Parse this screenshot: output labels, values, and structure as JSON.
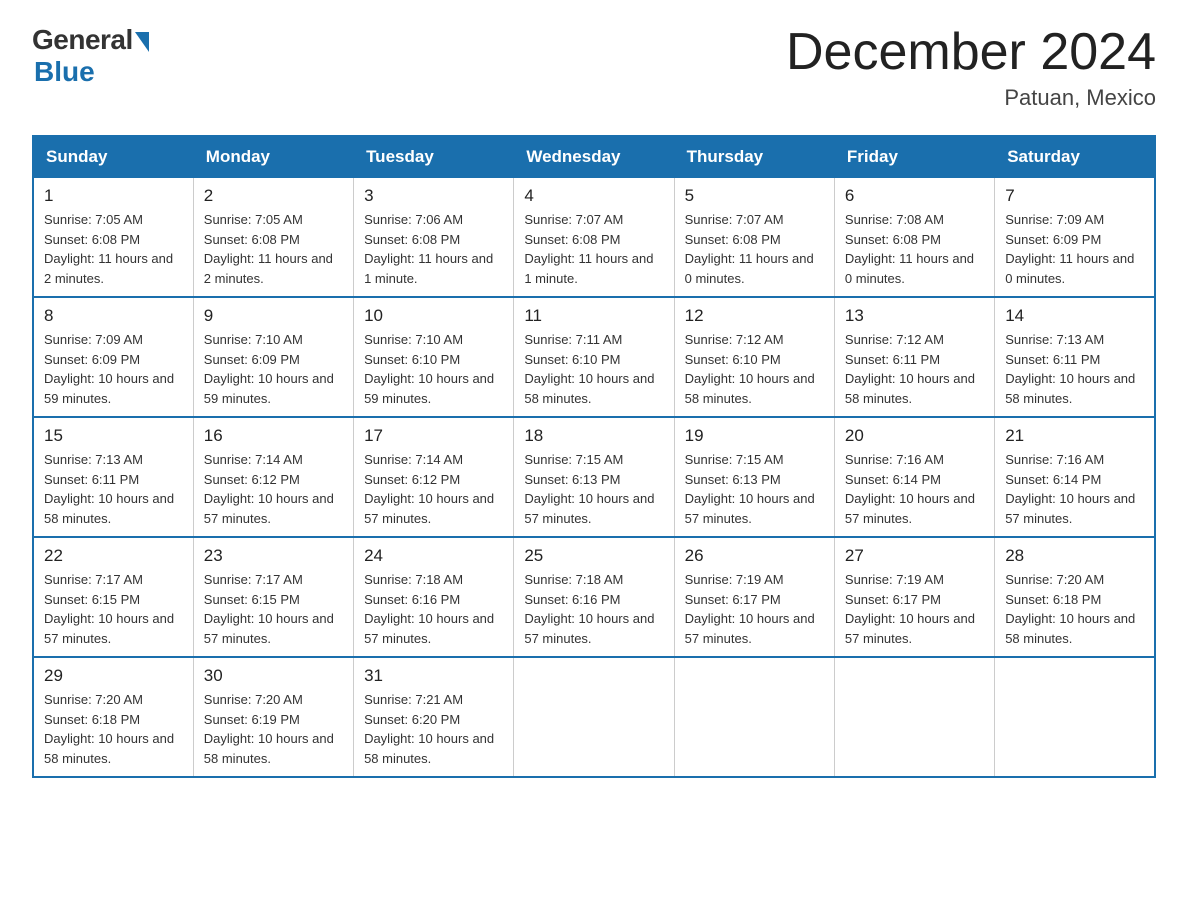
{
  "header": {
    "logo_general": "General",
    "logo_blue": "Blue",
    "month_title": "December 2024",
    "location": "Patuan, Mexico"
  },
  "calendar": {
    "days_of_week": [
      "Sunday",
      "Monday",
      "Tuesday",
      "Wednesday",
      "Thursday",
      "Friday",
      "Saturday"
    ],
    "weeks": [
      [
        {
          "day": "1",
          "sunrise": "7:05 AM",
          "sunset": "6:08 PM",
          "daylight": "11 hours and 2 minutes."
        },
        {
          "day": "2",
          "sunrise": "7:05 AM",
          "sunset": "6:08 PM",
          "daylight": "11 hours and 2 minutes."
        },
        {
          "day": "3",
          "sunrise": "7:06 AM",
          "sunset": "6:08 PM",
          "daylight": "11 hours and 1 minute."
        },
        {
          "day": "4",
          "sunrise": "7:07 AM",
          "sunset": "6:08 PM",
          "daylight": "11 hours and 1 minute."
        },
        {
          "day": "5",
          "sunrise": "7:07 AM",
          "sunset": "6:08 PM",
          "daylight": "11 hours and 0 minutes."
        },
        {
          "day": "6",
          "sunrise": "7:08 AM",
          "sunset": "6:08 PM",
          "daylight": "11 hours and 0 minutes."
        },
        {
          "day": "7",
          "sunrise": "7:09 AM",
          "sunset": "6:09 PM",
          "daylight": "11 hours and 0 minutes."
        }
      ],
      [
        {
          "day": "8",
          "sunrise": "7:09 AM",
          "sunset": "6:09 PM",
          "daylight": "10 hours and 59 minutes."
        },
        {
          "day": "9",
          "sunrise": "7:10 AM",
          "sunset": "6:09 PM",
          "daylight": "10 hours and 59 minutes."
        },
        {
          "day": "10",
          "sunrise": "7:10 AM",
          "sunset": "6:10 PM",
          "daylight": "10 hours and 59 minutes."
        },
        {
          "day": "11",
          "sunrise": "7:11 AM",
          "sunset": "6:10 PM",
          "daylight": "10 hours and 58 minutes."
        },
        {
          "day": "12",
          "sunrise": "7:12 AM",
          "sunset": "6:10 PM",
          "daylight": "10 hours and 58 minutes."
        },
        {
          "day": "13",
          "sunrise": "7:12 AM",
          "sunset": "6:11 PM",
          "daylight": "10 hours and 58 minutes."
        },
        {
          "day": "14",
          "sunrise": "7:13 AM",
          "sunset": "6:11 PM",
          "daylight": "10 hours and 58 minutes."
        }
      ],
      [
        {
          "day": "15",
          "sunrise": "7:13 AM",
          "sunset": "6:11 PM",
          "daylight": "10 hours and 58 minutes."
        },
        {
          "day": "16",
          "sunrise": "7:14 AM",
          "sunset": "6:12 PM",
          "daylight": "10 hours and 57 minutes."
        },
        {
          "day": "17",
          "sunrise": "7:14 AM",
          "sunset": "6:12 PM",
          "daylight": "10 hours and 57 minutes."
        },
        {
          "day": "18",
          "sunrise": "7:15 AM",
          "sunset": "6:13 PM",
          "daylight": "10 hours and 57 minutes."
        },
        {
          "day": "19",
          "sunrise": "7:15 AM",
          "sunset": "6:13 PM",
          "daylight": "10 hours and 57 minutes."
        },
        {
          "day": "20",
          "sunrise": "7:16 AM",
          "sunset": "6:14 PM",
          "daylight": "10 hours and 57 minutes."
        },
        {
          "day": "21",
          "sunrise": "7:16 AM",
          "sunset": "6:14 PM",
          "daylight": "10 hours and 57 minutes."
        }
      ],
      [
        {
          "day": "22",
          "sunrise": "7:17 AM",
          "sunset": "6:15 PM",
          "daylight": "10 hours and 57 minutes."
        },
        {
          "day": "23",
          "sunrise": "7:17 AM",
          "sunset": "6:15 PM",
          "daylight": "10 hours and 57 minutes."
        },
        {
          "day": "24",
          "sunrise": "7:18 AM",
          "sunset": "6:16 PM",
          "daylight": "10 hours and 57 minutes."
        },
        {
          "day": "25",
          "sunrise": "7:18 AM",
          "sunset": "6:16 PM",
          "daylight": "10 hours and 57 minutes."
        },
        {
          "day": "26",
          "sunrise": "7:19 AM",
          "sunset": "6:17 PM",
          "daylight": "10 hours and 57 minutes."
        },
        {
          "day": "27",
          "sunrise": "7:19 AM",
          "sunset": "6:17 PM",
          "daylight": "10 hours and 57 minutes."
        },
        {
          "day": "28",
          "sunrise": "7:20 AM",
          "sunset": "6:18 PM",
          "daylight": "10 hours and 58 minutes."
        }
      ],
      [
        {
          "day": "29",
          "sunrise": "7:20 AM",
          "sunset": "6:18 PM",
          "daylight": "10 hours and 58 minutes."
        },
        {
          "day": "30",
          "sunrise": "7:20 AM",
          "sunset": "6:19 PM",
          "daylight": "10 hours and 58 minutes."
        },
        {
          "day": "31",
          "sunrise": "7:21 AM",
          "sunset": "6:20 PM",
          "daylight": "10 hours and 58 minutes."
        },
        null,
        null,
        null,
        null
      ]
    ],
    "sunrise_label": "Sunrise:",
    "sunset_label": "Sunset:",
    "daylight_label": "Daylight:"
  }
}
